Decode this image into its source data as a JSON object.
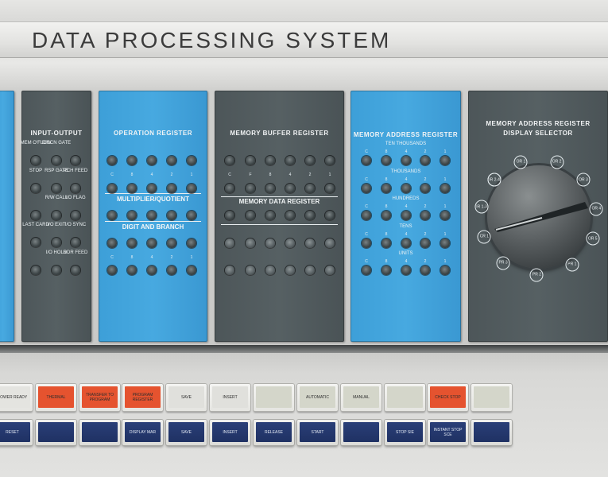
{
  "header": {
    "title": "DATA PROCESSING SYSTEM"
  },
  "panels": {
    "input_output": {
      "title": "INPUT-OUTPUT",
      "labels": [
        "MEM O'FLOW",
        "DISCN GATE",
        "STOP",
        "RSP GATE",
        "PCH FEED",
        "R/W CALL",
        "I/O FLAG",
        "LAST CARD",
        "I/O EXIT",
        "I/O SYNC",
        "I/O HOLD",
        "RDR FEED"
      ]
    },
    "operation_register": {
      "title": "OPERATION REGISTER",
      "section2": "MULTIPLIER/QUOTIENT",
      "section3": "DIGIT AND BRANCH"
    },
    "memory_buffer": {
      "title": "MEMORY BUFFER REGISTER",
      "section2": "MEMORY DATA REGISTER"
    },
    "memory_address": {
      "title": "MEMORY ADDRESS REGISTER",
      "groups": [
        "TEN THOUSANDS",
        "THOUSANDS",
        "HUNDREDS",
        "TENS",
        "UNITS"
      ]
    },
    "display_selector": {
      "title_line1": "MEMORY ADDRESS REGISTER",
      "title_line2": "DISPLAY SELECTOR",
      "positions": [
        "OR 1",
        "OR 2",
        "OR 3",
        "OR 4",
        "OR 5",
        "PR 1",
        "PR 2",
        "PR 3",
        "CR 1",
        "IR 1-3",
        "IR 2-4"
      ]
    },
    "bit_labels": [
      "C",
      "8",
      "4",
      "2",
      "1"
    ],
    "bit_labels_mbr": [
      "C",
      "F",
      "8",
      "4",
      "2",
      "1"
    ]
  },
  "keys": {
    "upper": [
      {
        "label": "POWER READY",
        "color": "#e4e4e0"
      },
      {
        "label": "THERMAL",
        "color": "#e5532f"
      },
      {
        "label": "TRANSFER TO PROGRAM",
        "color": "#e5532f"
      },
      {
        "label": "PROGRAM REGISTER",
        "color": "#e5532f"
      },
      {
        "label": "SAVE",
        "color": "#e0e0dc"
      },
      {
        "label": "INSERT",
        "color": "#e0e0dc"
      },
      {
        "label": "",
        "color": "#d4d6ca"
      },
      {
        "label": "AUTOMATIC",
        "color": "#d4d6ca"
      },
      {
        "label": "MANUAL",
        "color": "#d4d6ca"
      },
      {
        "label": "",
        "color": "#d4d6ca"
      },
      {
        "label": "CHECK STOP",
        "color": "#e5532f"
      },
      {
        "label": "",
        "color": "#d4d6ca"
      }
    ],
    "lower": [
      {
        "label": "RESET"
      },
      {
        "label": ""
      },
      {
        "label": ""
      },
      {
        "label": "DISPLAY MAR"
      },
      {
        "label": "SAVE"
      },
      {
        "label": "INSERT"
      },
      {
        "label": "RELEASE"
      },
      {
        "label": "START"
      },
      {
        "label": ""
      },
      {
        "label": "STOP SIE"
      },
      {
        "label": "INSTANT STOP SCE"
      },
      {
        "label": ""
      }
    ]
  }
}
